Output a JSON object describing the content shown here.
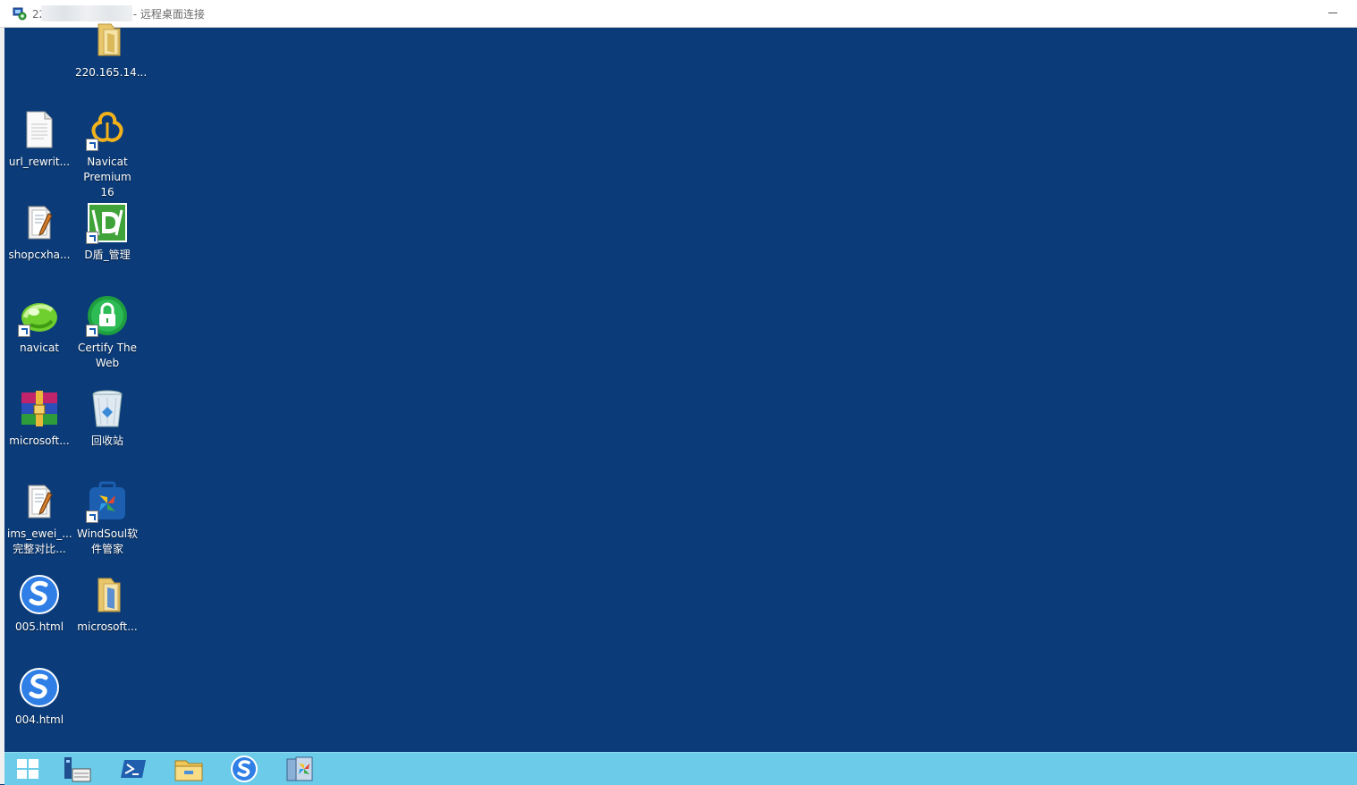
{
  "window": {
    "title_prefix": "22",
    "title_suffix": "5 - 远程桌面连接"
  },
  "desktop": {
    "icons": [
      {
        "name": "desktop-icon-folder-220",
        "label": "220.165.14...",
        "icon": "folder-icon"
      },
      {
        "name": "desktop-icon-url-rewrite",
        "label": "url_rewrit...",
        "icon": "text-file-icon"
      },
      {
        "name": "desktop-icon-navicat-premium",
        "label": "Navicat Premium 16",
        "icon": "navicat-premium-icon"
      },
      {
        "name": "desktop-icon-shopcxha",
        "label": "shopcxha...",
        "icon": "script-file-icon"
      },
      {
        "name": "desktop-icon-d-dun",
        "label": "D盾_管理",
        "icon": "d-shield-icon"
      },
      {
        "name": "desktop-icon-navicat",
        "label": "navicat",
        "icon": "navicat-icon"
      },
      {
        "name": "desktop-icon-certify-the-web",
        "label": "Certify The Web",
        "icon": "lock-icon"
      },
      {
        "name": "desktop-icon-microsoft-archive",
        "label": "microsoft...",
        "icon": "winrar-archive-icon"
      },
      {
        "name": "desktop-icon-recycle-bin",
        "label": "回收站",
        "icon": "recycle-bin-icon"
      },
      {
        "name": "desktop-icon-ims-ewei",
        "label": "ims_ewei_... 完整对比...",
        "icon": "script-file-icon"
      },
      {
        "name": "desktop-icon-windsoul",
        "label": "WindSoul软件管家",
        "icon": "windsoul-icon"
      },
      {
        "name": "desktop-icon-005-html",
        "label": "005.html",
        "icon": "sogou-browser-icon"
      },
      {
        "name": "desktop-icon-microsoft-folder",
        "label": "microsoft...",
        "icon": "folder-icon"
      },
      {
        "name": "desktop-icon-004-html",
        "label": "004.html",
        "icon": "sogou-browser-icon"
      }
    ]
  },
  "taskbar": {
    "items": [
      "start-icon",
      "server-manager-icon",
      "powershell-icon",
      "file-explorer-icon",
      "sogou-browser-icon",
      "windsoul-icon"
    ]
  },
  "colors": {
    "desktop_background": "#0b3b78",
    "taskbar_background": "#6bcbe8",
    "titlebar_background": "#ffffff"
  }
}
